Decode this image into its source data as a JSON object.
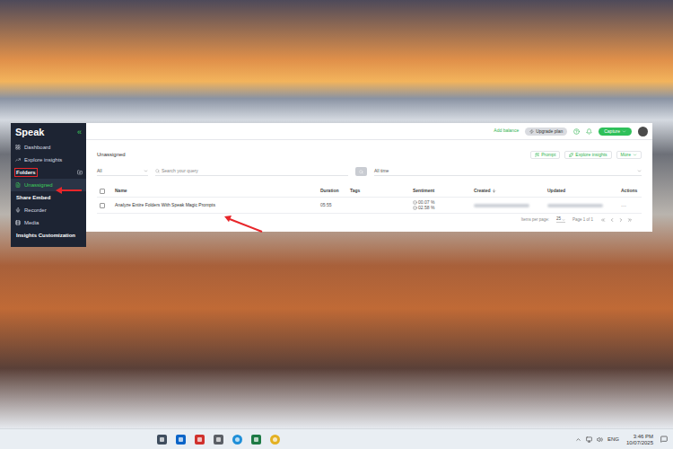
{
  "sidebar": {
    "logo": "Speak",
    "collapse": "«",
    "items": [
      {
        "label": "Dashboard",
        "kind": "item",
        "selected": false,
        "boxed": false,
        "pointed": false
      },
      {
        "label": "Explore insights",
        "kind": "item",
        "selected": false,
        "boxed": false,
        "pointed": false
      },
      {
        "label": "Folders",
        "kind": "section",
        "selected": false,
        "boxed": true,
        "pointed": false
      },
      {
        "label": "Unassigned",
        "kind": "item",
        "selected": true,
        "boxed": false,
        "pointed": true
      },
      {
        "label": "Share Embed",
        "kind": "section",
        "selected": false,
        "boxed": false,
        "pointed": false
      },
      {
        "label": "Recorder",
        "kind": "item",
        "selected": false,
        "boxed": false,
        "pointed": false
      },
      {
        "label": "Media",
        "kind": "item",
        "selected": false,
        "boxed": false,
        "pointed": false
      },
      {
        "label": "Insights Customization",
        "kind": "section",
        "selected": false,
        "boxed": false,
        "pointed": false
      }
    ]
  },
  "topbar": {
    "add_balance": "Add balance",
    "upgrade": "Upgrade plan",
    "capture": "Capture"
  },
  "page": {
    "title": "Unassigned",
    "actions": [
      "Prompt",
      "Explore insights",
      "More"
    ]
  },
  "filters": {
    "type": "All",
    "search_placeholder": "Search your query",
    "time": "All time"
  },
  "table": {
    "columns": [
      {
        "label": "Name",
        "sorted": false
      },
      {
        "label": "Duration",
        "sorted": false
      },
      {
        "label": "Tags",
        "sorted": false
      },
      {
        "label": "Sentiment",
        "sorted": false
      },
      {
        "label": "Created",
        "sorted": true
      },
      {
        "label": "Updated",
        "sorted": false
      },
      {
        "label": "Actions",
        "sorted": false
      }
    ],
    "rows": [
      {
        "name": "Analyze Entire Folders With Speak Magic Prompts",
        "duration": "05:55",
        "sentiment": [
          "00.07 %",
          "02.58 %"
        ],
        "checked": false,
        "selected": false,
        "pointed": true,
        "actions": "···"
      }
    ]
  },
  "pagination": {
    "per_page_label": "Items per page:",
    "per_page": "25",
    "page": "Page 1 of 1"
  },
  "taskbar": {
    "apps": [
      {
        "kind": "calculator",
        "color": "#3f4d5e"
      },
      {
        "kind": "outlook",
        "color": "#0a64c8"
      },
      {
        "kind": "pdf",
        "color": "#d0312d"
      },
      {
        "kind": "settings",
        "color": "#5b5f66"
      },
      {
        "kind": "edge",
        "color": "#1f8fd8"
      },
      {
        "kind": "excel",
        "color": "#1d7a45"
      },
      {
        "kind": "chrome",
        "color": "#e3b022"
      }
    ],
    "language": "ENG",
    "time": "3:46 PM",
    "date": "10/07/2025"
  }
}
